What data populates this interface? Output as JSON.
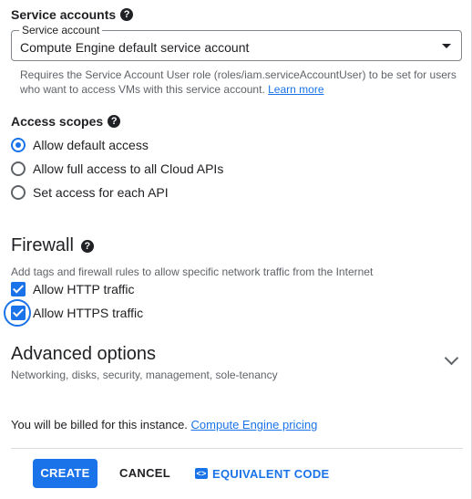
{
  "service_accounts": {
    "label": "Service accounts",
    "help_icon": "?",
    "select_floating_label": "Service account",
    "select_value": "Compute Engine default service account",
    "helper_text": "Requires the Service Account User role (roles/iam.serviceAccountUser) to be set for users who want to access VMs with this service account.",
    "helper_link": "Learn more"
  },
  "access_scopes": {
    "label": "Access scopes",
    "help_icon": "?",
    "options": [
      {
        "label": "Allow default access",
        "checked": true
      },
      {
        "label": "Allow full access to all Cloud APIs",
        "checked": false
      },
      {
        "label": "Set access for each API",
        "checked": false
      }
    ]
  },
  "firewall": {
    "heading": "Firewall",
    "help_icon": "?",
    "description": "Add tags and firewall rules to allow specific network traffic from the Internet",
    "options": [
      {
        "label": "Allow HTTP traffic",
        "checked": true
      },
      {
        "label": "Allow HTTPS traffic",
        "checked": true
      }
    ]
  },
  "advanced": {
    "title": "Advanced options",
    "subtitle": "Networking, disks, security, management, sole-tenancy"
  },
  "billing": {
    "text": "You will be billed for this instance.",
    "link": "Compute Engine pricing"
  },
  "actions": {
    "create": "CREATE",
    "cancel": "CANCEL",
    "equivalent_code": "EQUIVALENT CODE",
    "code_icon_glyph": "<>"
  },
  "colors": {
    "accent": "#1a73e8",
    "text": "#202124",
    "secondary_text": "#5f6368"
  }
}
